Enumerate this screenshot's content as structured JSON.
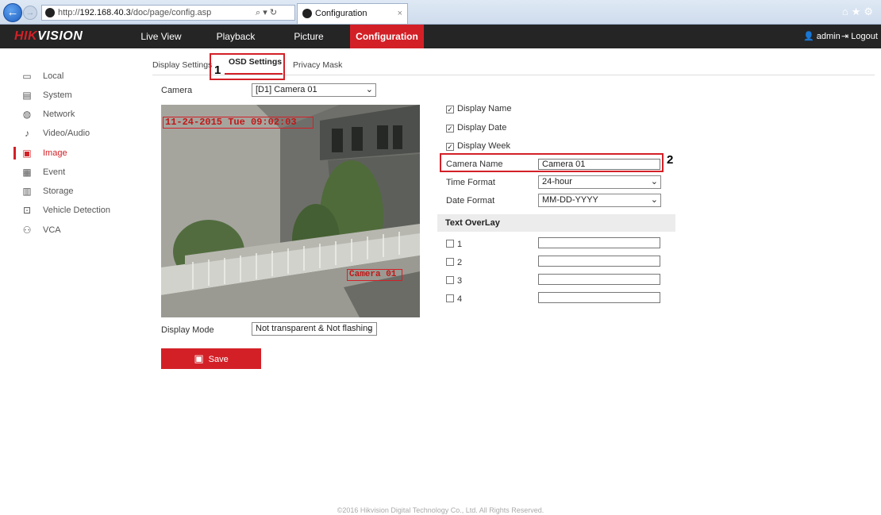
{
  "browser": {
    "url_prefix": "http://",
    "url_host": "192.168.40.3",
    "url_path": "/doc/page/config.asp",
    "tab_title": "Configuration"
  },
  "header": {
    "logo_prefix": "HIK",
    "logo_suffix": "VISION",
    "nav": [
      "Live View",
      "Playback",
      "Picture",
      "Configuration"
    ],
    "user": "admin",
    "logout": "Logout"
  },
  "sidebar": {
    "items": [
      {
        "label": "Local",
        "icon": "monitor-icon"
      },
      {
        "label": "System",
        "icon": "system-icon"
      },
      {
        "label": "Network",
        "icon": "globe-icon"
      },
      {
        "label": "Video/Audio",
        "icon": "video-audio-icon"
      },
      {
        "label": "Image",
        "icon": "image-icon"
      },
      {
        "label": "Event",
        "icon": "calendar-icon"
      },
      {
        "label": "Storage",
        "icon": "storage-icon"
      },
      {
        "label": "Vehicle Detection",
        "icon": "vehicle-detection-icon"
      },
      {
        "label": "VCA",
        "icon": "vca-icon"
      }
    ]
  },
  "subtabs": [
    "Display Settings",
    "OSD Settings",
    "Privacy Mask"
  ],
  "annotations": {
    "one": "1",
    "two": "2"
  },
  "form": {
    "camera_label": "Camera",
    "camera_value": "[D1] Camera 01",
    "osd_date_text": "11-24-2015 Tue 09:02:03",
    "osd_name_text": "Camera 01",
    "display_name": "Display Name",
    "display_date": "Display Date",
    "display_week": "Display Week",
    "camera_name_label": "Camera Name",
    "camera_name_value": "Camera 01",
    "time_format_label": "Time Format",
    "time_format_value": "24-hour",
    "date_format_label": "Date Format",
    "date_format_value": "MM-DD-YYYY",
    "text_overlay": "Text OverLay",
    "overlay_items": [
      "1",
      "2",
      "3",
      "4"
    ],
    "display_mode_label": "Display Mode",
    "display_mode_value": "Not transparent & Not flashing",
    "save": "Save"
  },
  "footer": "©2016 Hikvision Digital Technology Co., Ltd. All Rights Reserved."
}
